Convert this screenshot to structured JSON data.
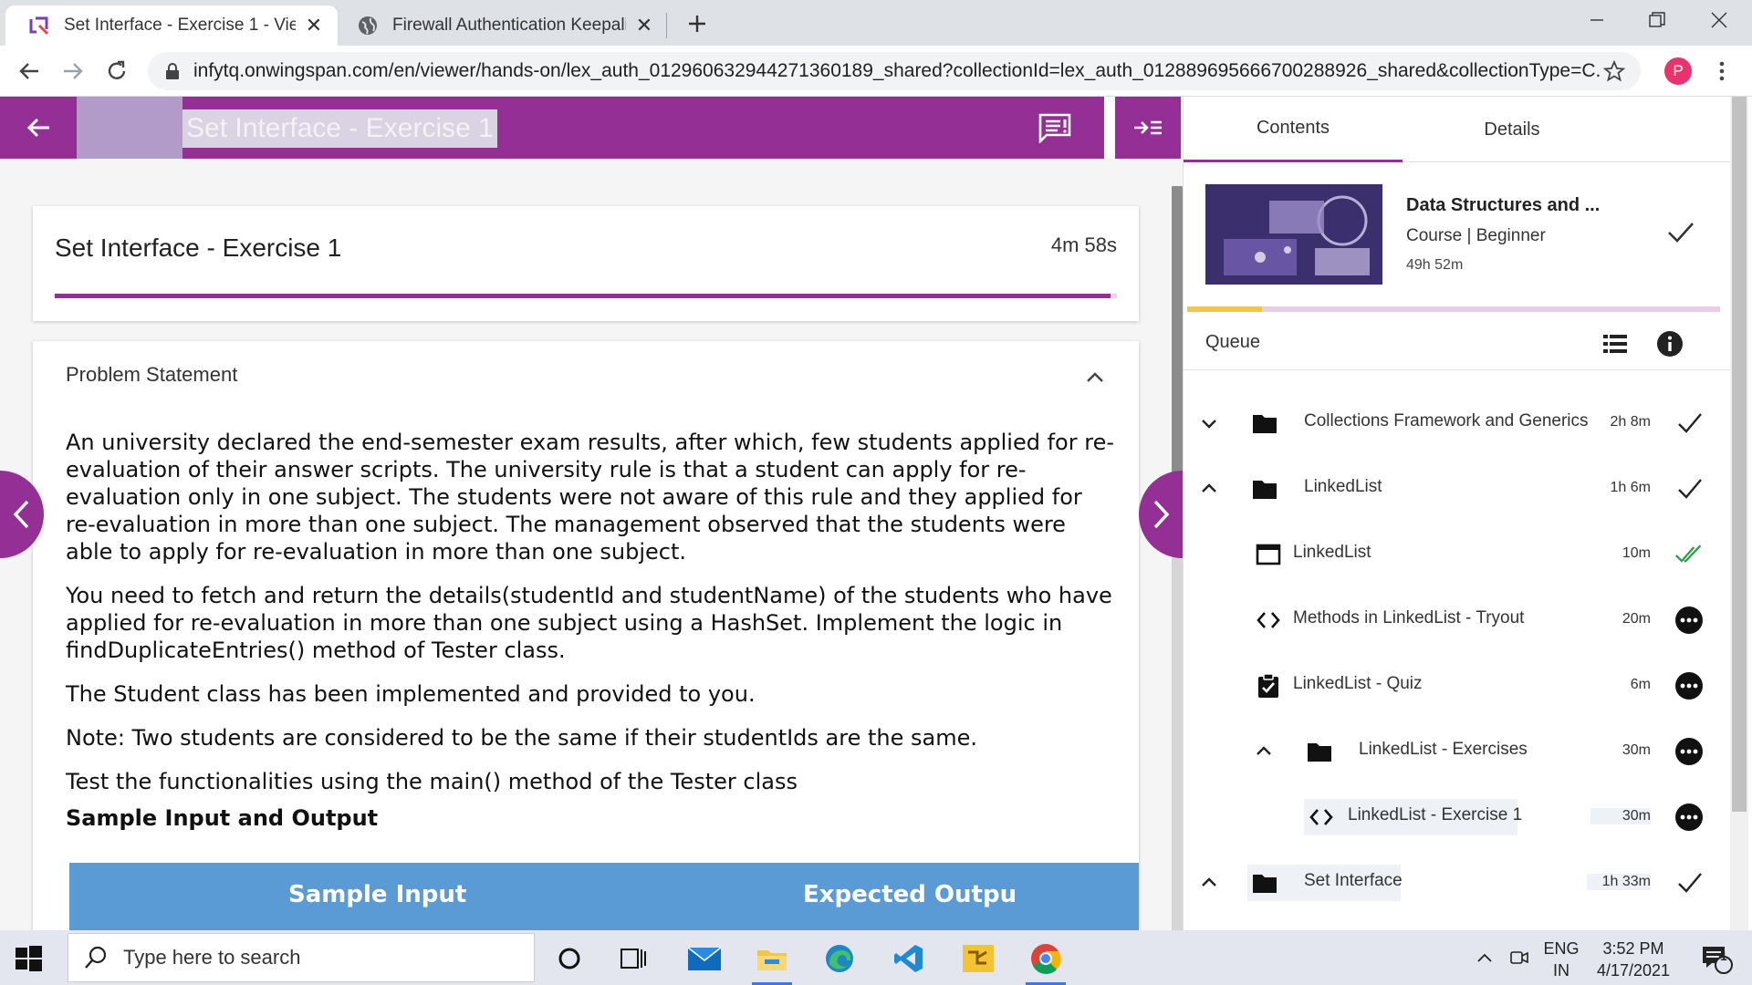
{
  "browser": {
    "tabs": [
      {
        "title": "Set Interface - Exercise 1 - Viewer",
        "active": true
      },
      {
        "title": "Firewall Authentication Keepalive",
        "active": false
      }
    ],
    "url": "infytq.onwingspan.com/en/viewer/hands-on/lex_auth_012960632944271360189_shared?collectionId=lex_auth_0128896956667002889​26_shared&collectionType=C...",
    "profile_initial": "P"
  },
  "header": {
    "title": "Set Interface - Exercise 1",
    "accent_color": "#932f95"
  },
  "exercise": {
    "title": "Set Interface - Exercise 1",
    "duration": "4m 58s",
    "progress_fraction": 0.994
  },
  "problem": {
    "section_title": "Problem Statement",
    "paragraphs": [
      "An university declared the end-semester exam results, after which, few students applied for re-evaluation of their answer scripts. The university rule is that a student can apply for re-evaluation only in one subject. The students were not aware of this rule and they applied for re-evaluation in more than one subject. The management observed that the students were able to apply for re-evaluation in more than one subject.",
      "You need to fetch and return the details(studentId and studentName) of the students who have applied for re-evaluation in more than one subject using a HashSet. Implement the logic in findDuplicateEntries() method of Tester class.",
      "The Student class has been implemented and provided to you.",
      "Note: Two students are considered to be the same if their studentIds are the same.",
      "Test the functionalities using the main() method of the Tester class"
    ],
    "sample_heading": "Sample Input and Output",
    "table_headers": [
      "Sample Input",
      "Expected Outpu"
    ]
  },
  "sidebar": {
    "tabs": [
      "Contents",
      "Details"
    ],
    "course": {
      "title": "Data Structures and ...",
      "type": "Course",
      "level": "Beginner",
      "duration": "49h 52m",
      "progress_fraction": 0.14
    },
    "queue_label": "Queue",
    "items": [
      {
        "label": "Collections Framework and Generics",
        "duration": "2h 8m"
      },
      {
        "label": "LinkedList",
        "duration": "1h 6m"
      },
      {
        "label": "LinkedList",
        "duration": "10m"
      },
      {
        "label": "Methods in LinkedList - Tryout",
        "duration": "20m"
      },
      {
        "label": "LinkedList - Quiz",
        "duration": "6m"
      },
      {
        "label": "LinkedList - Exercises",
        "duration": "30m"
      },
      {
        "label": "LinkedList - Exercise 1",
        "duration": "30m"
      },
      {
        "label": "Set Interface",
        "duration": "1h 33m"
      }
    ]
  },
  "taskbar": {
    "search_placeholder": "Type here to search",
    "language": [
      "ENG",
      "IN"
    ],
    "time": "3:52 PM",
    "date": "4/17/2021",
    "notification_count": "1"
  }
}
